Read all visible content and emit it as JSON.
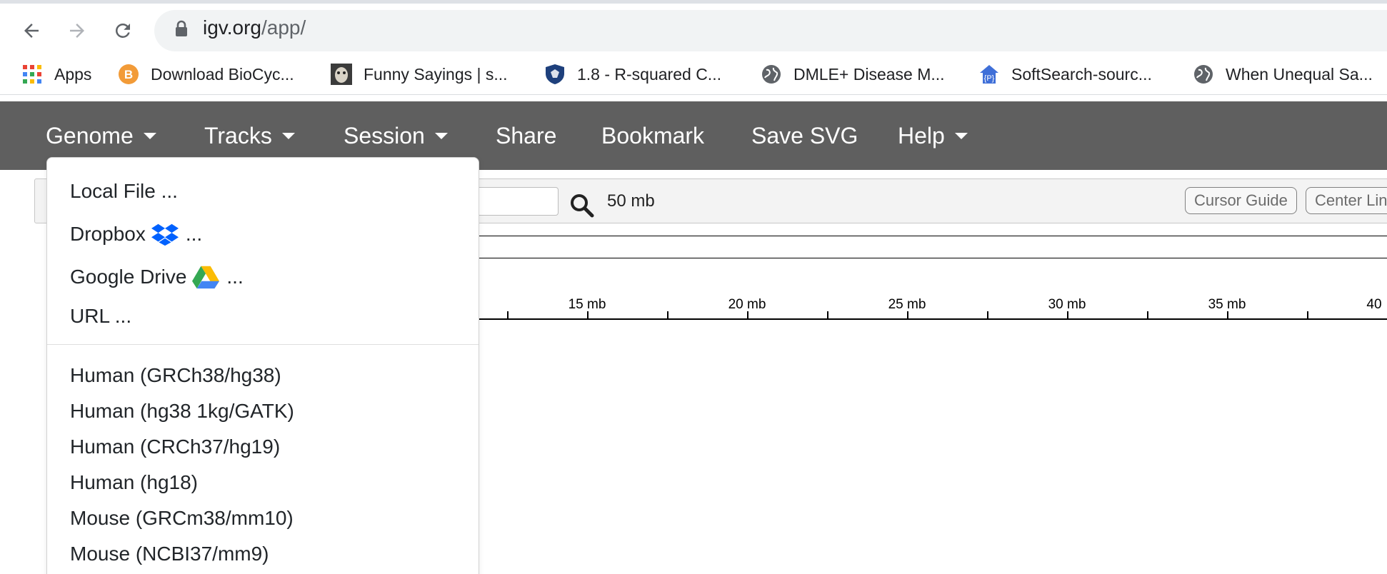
{
  "browser": {
    "url_host": "igv.org",
    "url_path": "/app/",
    "bookmarks": [
      {
        "label": "Apps",
        "icon": "apps-grid-icon"
      },
      {
        "label": "Download BioCyc...",
        "icon": "biocyc-icon"
      },
      {
        "label": "Funny Sayings | s...",
        "icon": "funny-sayings-icon"
      },
      {
        "label": "1.8 - R-squared C...",
        "icon": "penn-state-shield-icon"
      },
      {
        "label": "DMLE+ Disease M...",
        "icon": "globe-icon"
      },
      {
        "label": "SoftSearch-sourc...",
        "icon": "house-p-icon"
      },
      {
        "label": "When Unequal Sa...",
        "icon": "globe-icon"
      }
    ]
  },
  "igv_nav": {
    "menus": [
      {
        "label": "Genome",
        "has_caret": true
      },
      {
        "label": "Tracks",
        "has_caret": true
      },
      {
        "label": "Session",
        "has_caret": true
      },
      {
        "label": "Share",
        "has_caret": false
      },
      {
        "label": "Bookmark",
        "has_caret": false
      },
      {
        "label": "Save SVG",
        "has_caret": false
      },
      {
        "label": "Help",
        "has_caret": true
      }
    ]
  },
  "igv": {
    "zoom_label": "50 mb",
    "cursor_guide": "Cursor Guide",
    "center_line": "Center Lin",
    "ruler_ticks": [
      "15 mb",
      "20 mb",
      "25 mb",
      "30 mb",
      "35 mb",
      "40"
    ]
  },
  "genome_dropdown": {
    "load_items": [
      {
        "label": "Local File ...",
        "icon": null
      },
      {
        "label": "Dropbox",
        "suffix": "...",
        "icon": "dropbox-icon"
      },
      {
        "label": "Google Drive",
        "suffix": "...",
        "icon": "google-drive-icon"
      },
      {
        "label": "URL ...",
        "icon": null
      }
    ],
    "genomes": [
      "Human (GRCh38/hg38)",
      "Human (hg38 1kg/GATK)",
      "Human (CRCh37/hg19)",
      "Human (hg18)",
      "Mouse (GRCm38/mm10)",
      "Mouse (NCBI37/mm9)"
    ]
  },
  "colors": {
    "igv_nav_bg": "#5f5f5f",
    "omnibox_bg": "#f1f3f4",
    "dropbox_blue": "#0061fe"
  }
}
